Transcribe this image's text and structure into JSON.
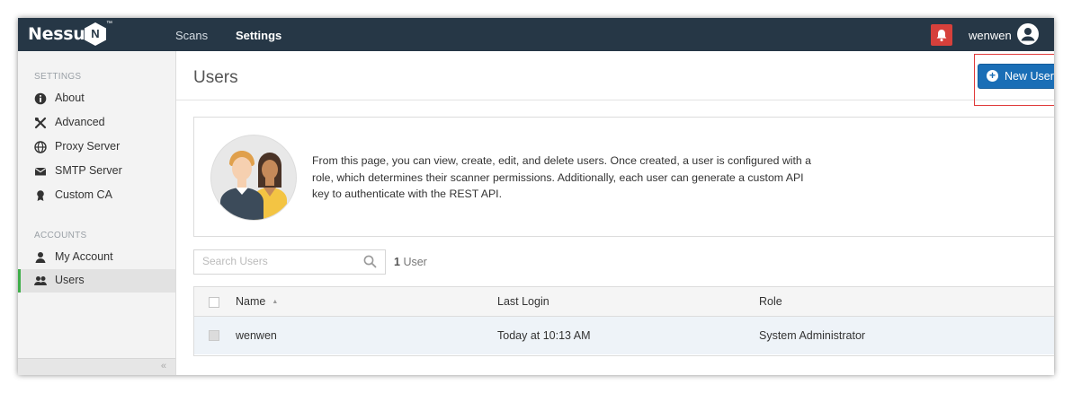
{
  "header": {
    "logo": "Nessus",
    "logo_mark": "N",
    "trademark": "™",
    "nav": [
      "Scans",
      "Settings"
    ],
    "username": "wenwen",
    "colors": {
      "topbar": "#263746",
      "alert": "#d6403b"
    }
  },
  "sidebar": {
    "settings_heading": "SETTINGS",
    "settings_items": [
      {
        "label": "About",
        "icon": "info-icon"
      },
      {
        "label": "Advanced",
        "icon": "tools-icon"
      },
      {
        "label": "Proxy Server",
        "icon": "globe-icon"
      },
      {
        "label": "SMTP Server",
        "icon": "envelope-icon"
      },
      {
        "label": "Custom CA",
        "icon": "certificate-icon"
      }
    ],
    "accounts_heading": "ACCOUNTS",
    "accounts_items": [
      {
        "label": "My Account",
        "icon": "user-icon"
      },
      {
        "label": "Users",
        "icon": "users-icon",
        "active": true
      }
    ],
    "collapse_glyph": "«"
  },
  "main": {
    "title": "Users",
    "new_user_label": "New User",
    "info_text": "From this page, you can view, create, edit, and delete users. Once created, a user is configured with a role, which determines their scanner permissions. Additionally, each user can generate a custom API key to authenticate with the REST API.",
    "search_placeholder": "Search Users",
    "count_number": "1",
    "count_label": "User",
    "table": {
      "columns": [
        "Name",
        "Last Login",
        "Role"
      ],
      "rows": [
        {
          "name": "wenwen",
          "last_login": "Today at 10:13 AM",
          "role": "System Administrator"
        }
      ]
    },
    "colors": {
      "primary_button": "#1a6eb6",
      "active_indicator": "#3fae49",
      "highlight": "#e03a3a"
    }
  }
}
